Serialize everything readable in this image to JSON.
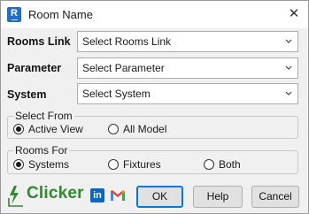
{
  "window": {
    "title": "Room Name",
    "app_icon": "revit-r-icon",
    "close_glyph": "✕"
  },
  "app_icon_letter": "R",
  "fields": {
    "rooms_link": {
      "label": "Rooms Link",
      "value": "Select Rooms Link"
    },
    "parameter": {
      "label": "Parameter",
      "value": "Select Parameter"
    },
    "system": {
      "label": "System",
      "value": "Select System"
    }
  },
  "select_from": {
    "legend": "Select From",
    "options": [
      {
        "label": "Active View",
        "checked": true
      },
      {
        "label": "All Model",
        "checked": false
      }
    ]
  },
  "rooms_for": {
    "legend": "Rooms For",
    "options": [
      {
        "label": "Systems",
        "checked": true
      },
      {
        "label": "Fixtures",
        "checked": false
      },
      {
        "label": "Both",
        "checked": false
      }
    ]
  },
  "footer": {
    "brand": "Clicker",
    "linkedin_letters": "in",
    "buttons": {
      "ok": "OK",
      "help": "Help",
      "cancel": "Cancel"
    }
  },
  "colors": {
    "brand_green": "#2e8b2e",
    "linkedin_blue": "#0a66c2",
    "revit_blue": "#1f6fc8"
  }
}
